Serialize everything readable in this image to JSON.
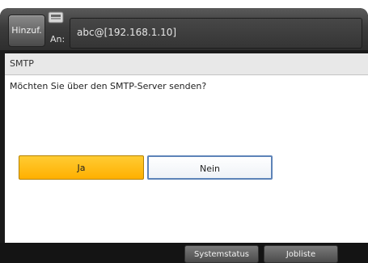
{
  "header": {
    "add_label": "Hinzuf.",
    "to_label": "An:",
    "address": "abc@[192.168.1.10]"
  },
  "dialog": {
    "title": "SMTP",
    "message": "Möchten Sie über den SMTP-Server senden?",
    "yes_label": "Ja",
    "no_label": "Nein"
  },
  "footer": {
    "system_status_label": "Systemstatus",
    "job_list_label": "Jobliste"
  },
  "colors": {
    "yes_button": "#ffbb00",
    "no_button_border": "#5d83b8",
    "frame": "#1a1a1a"
  },
  "icons": {
    "device": "printer-device-icon"
  }
}
